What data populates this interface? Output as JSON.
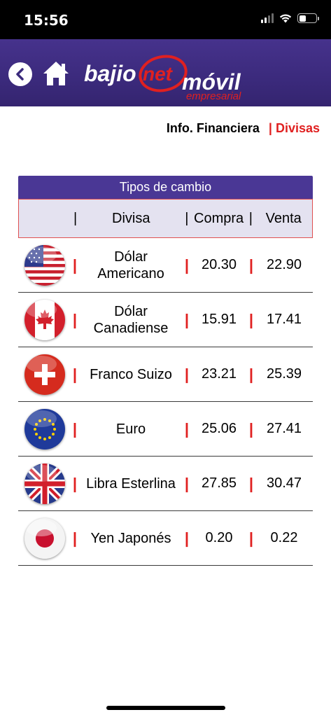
{
  "status_bar": {
    "time": "15:56"
  },
  "header": {
    "logo": {
      "part1": "bajio",
      "part2": "net",
      "part3": "móvil",
      "part4": "empresarial"
    }
  },
  "breadcrumb": {
    "parent": "Info. Financiera",
    "separator": "|",
    "current": "Divisas"
  },
  "table": {
    "title": "Tipos de cambio",
    "columns": {
      "divisa": "Divisa",
      "compra": "Compra",
      "venta": "Venta",
      "separator": "|"
    },
    "rows": [
      {
        "flag": "usa-flag-icon",
        "name_line1": "Dólar",
        "name_line2": "Americano",
        "compra": "20.30",
        "venta": "22.90"
      },
      {
        "flag": "canada-flag-icon",
        "name_line1": "Dólar",
        "name_line2": "Canadiense",
        "compra": "15.91",
        "venta": "17.41"
      },
      {
        "flag": "switzerland-flag-icon",
        "name_line1": "Franco Suizo",
        "name_line2": "",
        "compra": "23.21",
        "venta": "25.39"
      },
      {
        "flag": "eu-flag-icon",
        "name_line1": "Euro",
        "name_line2": "",
        "compra": "25.06",
        "venta": "27.41"
      },
      {
        "flag": "uk-flag-icon",
        "name_line1": "Libra Esterlina",
        "name_line2": "",
        "compra": "27.85",
        "venta": "30.47"
      },
      {
        "flag": "japan-flag-icon",
        "name_line1": "Yen Japonés",
        "name_line2": "",
        "compra": "0.20",
        "venta": "0.22"
      }
    ]
  },
  "colors": {
    "header_purple": "#3b2a7c",
    "accent_red": "#e02020",
    "title_bar": "#4a3795",
    "column_header_bg": "#e4e2f0"
  }
}
